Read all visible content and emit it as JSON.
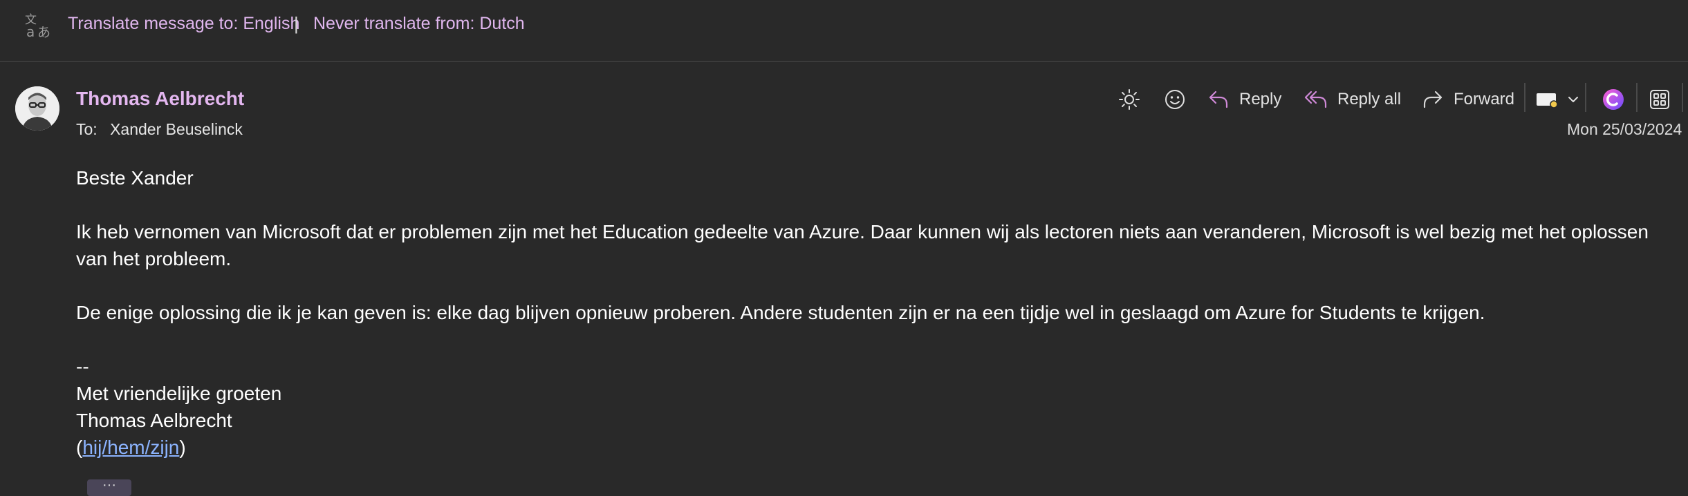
{
  "translate_bar": {
    "icon": "translate-icon",
    "translate_label": "Translate message to: English",
    "separator": "|",
    "never_translate_label": "Never translate from: Dutch"
  },
  "message": {
    "sender_name": "Thomas Aelbrecht",
    "to_label": "To:",
    "recipient": "Xander Beuselinck",
    "date": "Mon 25/03/2024",
    "body": {
      "greeting": "Beste Xander",
      "paragraph1": "Ik heb vernomen van Microsoft dat er problemen zijn met het Education gedeelte van Azure. Daar kunnen wij als lectoren niets aan veranderen, Microsoft is wel bezig met het oplossen van het probleem.",
      "paragraph2": "De enige oplossing die ik je kan geven is: elke dag blijven opnieuw proberen. Andere studenten zijn er na een tijdje wel in geslaagd om Azure for Students te krijgen.",
      "sig_dashes": "--",
      "sig_closing": "Met vriendelijke groeten",
      "sig_name": "Thomas Aelbrecht",
      "pronouns_open": "(",
      "pronouns": "hij/hem/zijn",
      "pronouns_close": ")"
    },
    "show_more": "···"
  },
  "toolbar": {
    "icons": [
      "brightness-icon",
      "emoji-icon",
      "reply-icon",
      "reply-all-icon",
      "forward-icon",
      "tag-icon",
      "chevron-down-icon",
      "copilot-icon",
      "apps-icon"
    ],
    "reply_label": "Reply",
    "reply_all_label": "Reply all",
    "forward_label": "Forward"
  },
  "colors": {
    "background": "#292929",
    "accent": "#e4b7f0",
    "link": "#8cb4ff"
  }
}
